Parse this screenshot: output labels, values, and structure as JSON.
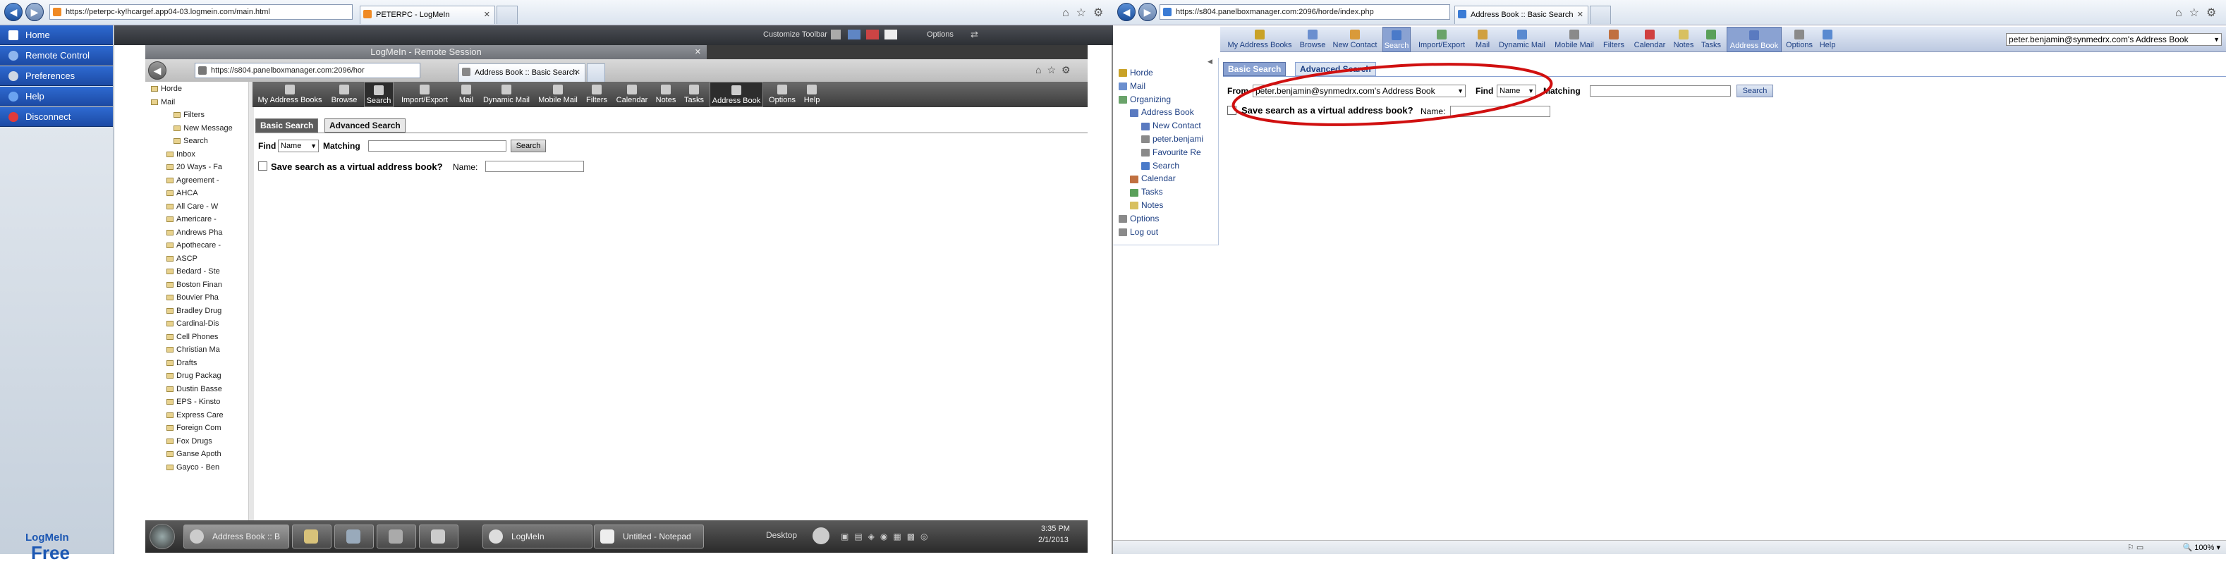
{
  "left_browser": {
    "address_url": "https://peterpc-ky!hcargef.app04-03.logmein.com/main.html",
    "tab_title": "PETERPC - LogMeIn",
    "title_icons": [
      "home-icon",
      "star-icon",
      "gear-icon"
    ]
  },
  "lmi_sidebar": {
    "items": [
      {
        "label": "Home"
      },
      {
        "label": "Remote Control"
      },
      {
        "label": "Preferences"
      },
      {
        "label": "Help"
      },
      {
        "label": "Disconnect"
      }
    ],
    "logo_top": "LogMeIn",
    "logo_bottom": "Free"
  },
  "remote_toolbar": {
    "customize_label": "Customize Toolbar",
    "options_label": "Options"
  },
  "session": {
    "title": "LogMeIn - Remote Session",
    "browser": {
      "address_url": "https://s804.panelboxmanager.com:2096/hor",
      "tab_title": "Address Book :: Basic Search"
    },
    "horde_nav": [
      {
        "label": "My Address Books"
      },
      {
        "label": "Browse"
      },
      {
        "label": "Search",
        "active": true
      },
      {
        "label": "Import/Export"
      },
      {
        "label": "Mail"
      },
      {
        "label": "Dynamic Mail"
      },
      {
        "label": "Mobile Mail"
      },
      {
        "label": "Filters"
      },
      {
        "label": "Calendar"
      },
      {
        "label": "Notes"
      },
      {
        "label": "Tasks"
      },
      {
        "label": "Address Book",
        "active": true
      },
      {
        "label": "Options"
      },
      {
        "label": "Help"
      }
    ],
    "tree": [
      "Horde",
      "Mail",
      "Filters",
      "New Message",
      "Search",
      "Inbox",
      "20 Ways - Fa",
      "Agreement -",
      "AHCA",
      "All Care - W",
      "Americare -",
      "Andrews Pha",
      "Apothecare -",
      "ASCP",
      "Bedard - Ste",
      "Boston Finan",
      "Bouvier Pha",
      "Bradley Drug",
      "Cardinal-Dis",
      "Cell Phones",
      "Christian Ma",
      "Drafts",
      "Drug Packag",
      "Dustin Basse",
      "EPS - Kinsto",
      "Express Care",
      "Foreign Com",
      "Fox Drugs",
      "Ganse Apoth",
      "Gayco - Ben"
    ],
    "tabs": {
      "basic": "Basic Search",
      "advanced": "Advanced Search"
    },
    "find_label": "Find",
    "find_value": "Name",
    "matching_label": "Matching",
    "search_button": "Search",
    "save_label": "Save search as a virtual address book?",
    "name_label": "Name:",
    "taskbar": {
      "tasks": [
        {
          "label": "Address Book :: B"
        },
        {
          "label": ""
        },
        {
          "label": ""
        },
        {
          "label": ""
        },
        {
          "label": ""
        },
        {
          "label": "LogMeIn"
        },
        {
          "label": "Untitled - Notepad"
        }
      ],
      "desktop_label": "Desktop",
      "time": "3:35 PM",
      "date": "2/1/2013"
    }
  },
  "right_browser": {
    "address_url": "https://s804.panelboxmanager.com:2096/horde/index.php",
    "tab_title": "Address Book :: Basic Search",
    "nav": [
      {
        "label": "My Address Books"
      },
      {
        "label": "Browse"
      },
      {
        "label": "New Contact"
      },
      {
        "label": "Search",
        "active": true
      },
      {
        "label": "Import/Export"
      },
      {
        "label": "Mail"
      },
      {
        "label": "Dynamic Mail"
      },
      {
        "label": "Mobile Mail"
      },
      {
        "label": "Filters"
      },
      {
        "label": "Calendar"
      },
      {
        "label": "Notes"
      },
      {
        "label": "Tasks"
      },
      {
        "label": "Address Book",
        "active": true
      },
      {
        "label": "Options"
      },
      {
        "label": "Help"
      }
    ],
    "address_book_selector": "peter.benjamin@synmedrx.com's Address Book",
    "tree": [
      {
        "label": "Horde"
      },
      {
        "label": "Mail"
      },
      {
        "label": "Organizing"
      },
      {
        "label": "Address Book"
      },
      {
        "label": "New Contact"
      },
      {
        "label": "peter.benjami"
      },
      {
        "label": "Favourite Re"
      },
      {
        "label": "Search"
      },
      {
        "label": "Calendar"
      },
      {
        "label": "Tasks"
      },
      {
        "label": "Notes"
      },
      {
        "label": "Options"
      },
      {
        "label": "Log out"
      }
    ],
    "tabs": {
      "basic": "Basic Search",
      "advanced": "Advanced Search"
    },
    "from_label": "From",
    "from_value": "peter.benjamin@synmedrx.com's Address Book",
    "find_label": "Find",
    "find_value": "Name",
    "matching_label": "Matching",
    "search_button": "Search",
    "save_label": "Save search as a virtual address book?",
    "name_label": "Name:",
    "zoom": "100%",
    "highlight_color": "#d01010"
  }
}
